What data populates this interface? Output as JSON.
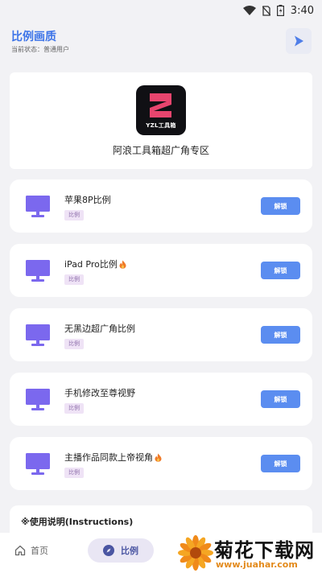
{
  "status_bar": {
    "time": "3:40",
    "icons": [
      "wifi-icon",
      "no-sim-icon",
      "battery-icon"
    ]
  },
  "header": {
    "title": "比例画质",
    "subtitle": "当前状态：普通用户",
    "action_icon": "play-icon"
  },
  "logo_card": {
    "logo_text": "YZL工具箱",
    "zone_title": "阿浪工具箱超广角专区"
  },
  "items": [
    {
      "title": "苹果8P比例",
      "hot": false,
      "tag": "比例",
      "button": "解锁"
    },
    {
      "title": "iPad Pro比例",
      "hot": true,
      "tag": "比例",
      "button": "解锁"
    },
    {
      "title": "无黑边超广角比例",
      "hot": false,
      "tag": "比例",
      "button": "解锁"
    },
    {
      "title": "手机修改至尊视野",
      "hot": false,
      "tag": "比例",
      "button": "解锁"
    },
    {
      "title": "主播作品同款上帝视角",
      "hot": true,
      "tag": "比例",
      "button": "解锁"
    }
  ],
  "instructions": {
    "title": "※使用说明(Instructions)"
  },
  "bottom_nav": {
    "home": "首页",
    "ratio": "比例"
  },
  "watermark": {
    "main": "菊花下载网",
    "url": "www.juahar.com"
  },
  "colors": {
    "accent": "#3d74e8",
    "button": "#5b8df0",
    "monitor": "#7b68ee",
    "tag_bg": "#efe3f6"
  }
}
